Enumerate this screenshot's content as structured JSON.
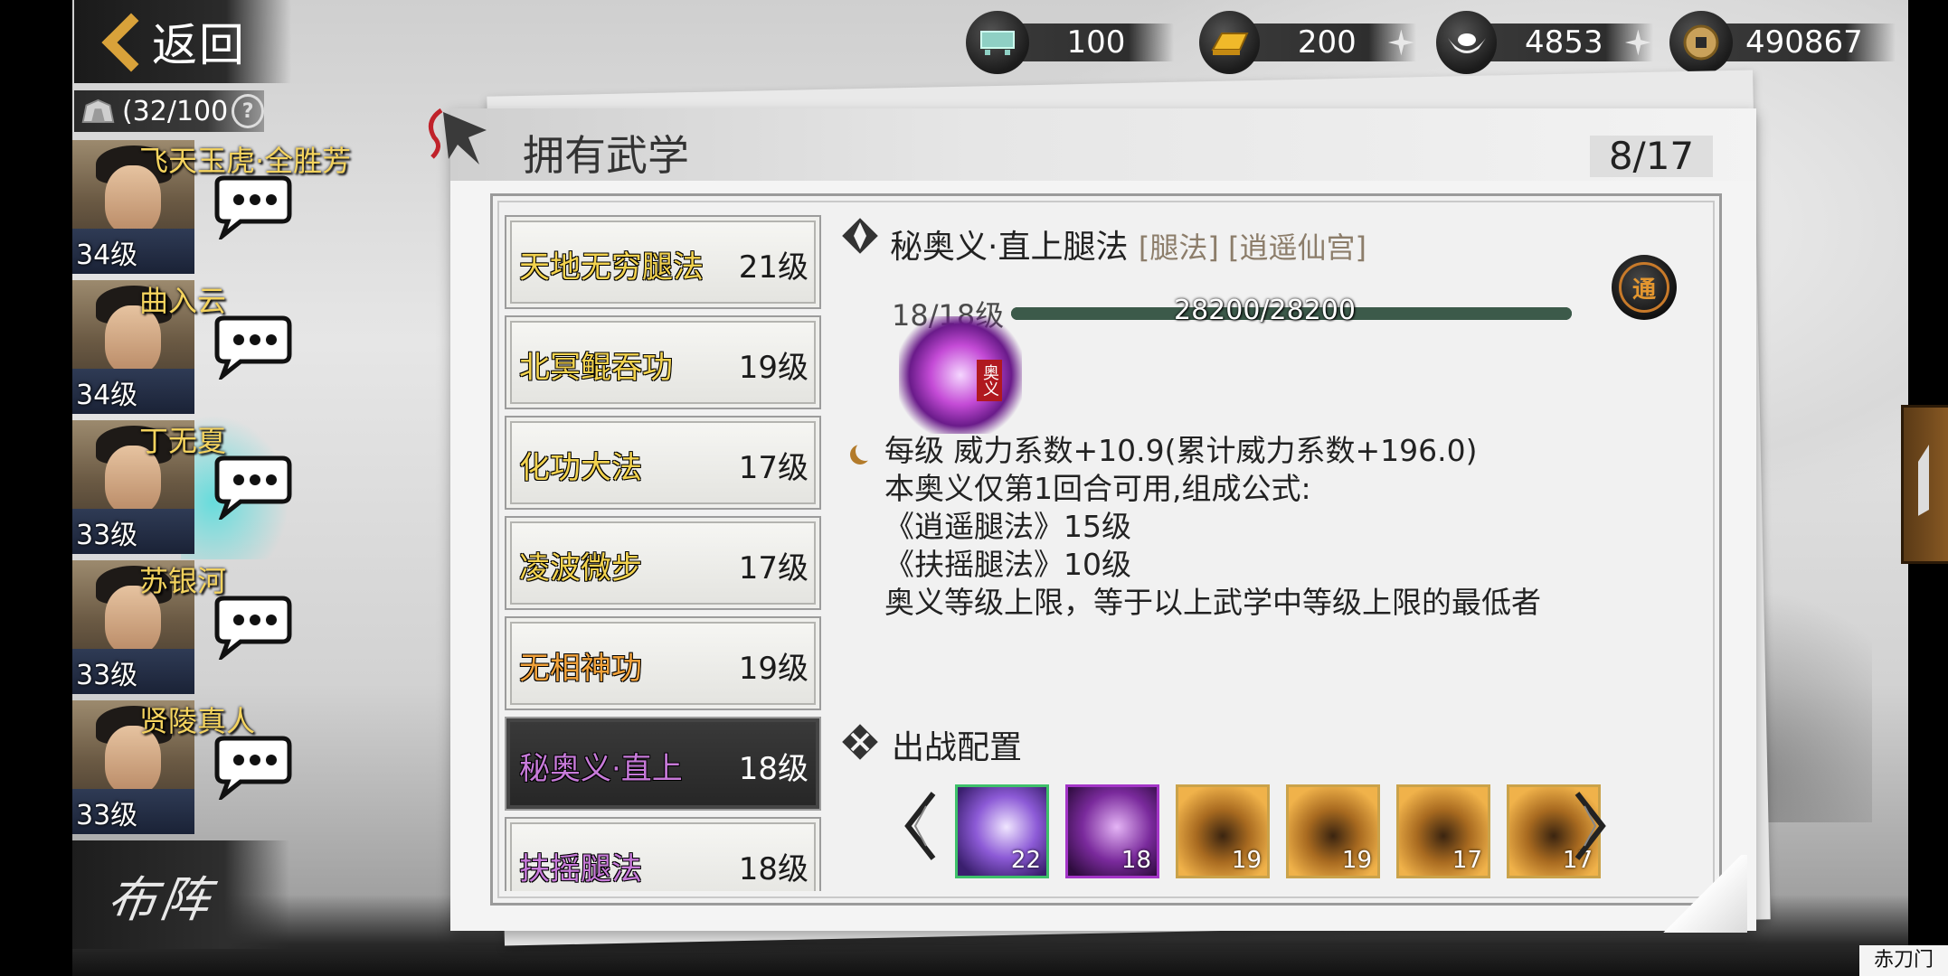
{
  "nav": {
    "back_label": "返回"
  },
  "capacity": {
    "text": "(32/100"
  },
  "characters": [
    {
      "name": "飞天玉虎·全胜芳",
      "level": "34级",
      "active": false
    },
    {
      "name": "曲入云",
      "level": "34级",
      "active": false
    },
    {
      "name": "丁无夏",
      "level": "33级",
      "active": true
    },
    {
      "name": "苏银河",
      "level": "33级",
      "active": false
    },
    {
      "name": "贤陵真人",
      "level": "33级",
      "active": false
    }
  ],
  "formation": {
    "label": "布阵"
  },
  "currencies": [
    {
      "icon": "cart-icon",
      "value": "100",
      "has_plus": false
    },
    {
      "icon": "gold-bar-icon",
      "value": "200",
      "has_plus": true
    },
    {
      "icon": "silver-ingot-icon",
      "value": "4853",
      "has_plus": true
    },
    {
      "icon": "copper-coin-icon",
      "value": "490867",
      "has_plus": false
    }
  ],
  "panel": {
    "title": "拥有武学",
    "page": "8/17"
  },
  "skills": [
    {
      "name": "天地无穷腿法",
      "level": "21级",
      "color": "#f2d24e",
      "selected": false
    },
    {
      "name": "北冥鲲吞功",
      "level": "19级",
      "color": "#f2d24e",
      "selected": false
    },
    {
      "name": "化功大法",
      "level": "17级",
      "color": "#f2d24e",
      "selected": false
    },
    {
      "name": "凌波微步",
      "level": "17级",
      "color": "#f2d24e",
      "selected": false
    },
    {
      "name": "无相神功",
      "level": "19级",
      "color": "#f2a23a",
      "selected": false
    },
    {
      "name": "秘奥义·直上",
      "level": "18级",
      "color": "#c77ad9",
      "selected": true
    },
    {
      "name": "扶摇腿法",
      "level": "18级",
      "color": "#c77ad9",
      "selected": false
    }
  ],
  "detail": {
    "name": "秘奥义·直上腿法",
    "tags": "[腿法] [逍遥仙宫]",
    "level_text": "18/18级",
    "exp_text": "28200/28200",
    "exp_ratio": 1.0,
    "badge": "通",
    "icon_tag": "奥义",
    "desc_line1": "每级  威力系数+10.9(累计威力系数+196.0)",
    "desc_line2": "本奥义仅第1回合可用,组成公式:",
    "desc_line3": "《逍遥腿法》15级",
    "desc_line4": "《扶摇腿法》10级",
    "desc_line5": "奥义等级上限，等于以上武学中等级上限的最低者"
  },
  "deploy": {
    "title": "出战配置",
    "slots": [
      {
        "level": "22",
        "style": "green"
      },
      {
        "level": "18",
        "style": "purple"
      },
      {
        "level": "19",
        "style": "gold"
      },
      {
        "level": "19",
        "style": "gold"
      },
      {
        "level": "17",
        "style": "gold"
      },
      {
        "level": "17",
        "style": "gold"
      }
    ]
  },
  "corner_label": "赤刀门"
}
